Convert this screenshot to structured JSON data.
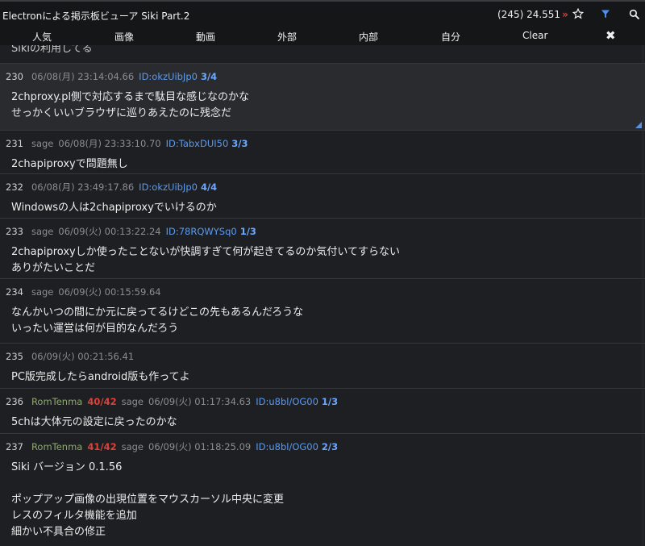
{
  "app": {
    "title": "Electronによる掲示板ビューア Siki Part.2",
    "count": "(245) 24.551",
    "up_glyph": "»"
  },
  "tabs": [
    "人気",
    "画像",
    "動画",
    "外部",
    "内部",
    "自分",
    "Clear"
  ],
  "close_glyph": "✖",
  "cut_text": "Sikiの利用してる",
  "posts": [
    {
      "num": "230",
      "name": "",
      "res_count": "",
      "mail": "",
      "date": "06/08(月) 23:14:04.66",
      "id": "ID:okzUibJp0",
      "id_count": "3/4",
      "lines": [
        "2chproxy.pl側で対応するまで駄目な感じなのかな",
        "せっかくいいブラウザに巡りあえたのに残念だ"
      ],
      "highlight": true
    },
    {
      "num": "231",
      "name": "",
      "res_count": "",
      "mail": "sage",
      "date": "06/08(月) 23:33:10.70",
      "id": "ID:TabxDUI50",
      "id_count": "3/3",
      "lines": [
        "2chapiproxyで問題無し"
      ]
    },
    {
      "num": "232",
      "name": "",
      "res_count": "",
      "mail": "",
      "date": "06/08(月) 23:49:17.86",
      "id": "ID:okzUibJp0",
      "id_count": "4/4",
      "lines": [
        "Windowsの人は2chapiproxyでいけるのか"
      ]
    },
    {
      "num": "233",
      "name": "",
      "res_count": "",
      "mail": "sage",
      "date": "06/09(火) 00:13:22.24",
      "id": "ID:78RQWYSq0",
      "id_count": "1/3",
      "lines": [
        "2chapiproxyしか使ったことないが快調すぎて何が起きてるのか気付いてすらない",
        "ありがたいことだ"
      ]
    },
    {
      "num": "234",
      "name": "",
      "res_count": "",
      "mail": "sage",
      "date": "06/09(火) 00:15:59.64",
      "id": "",
      "id_count": "",
      "lines": [
        "なんかいつの間にか元に戻ってるけどこの先もあるんだろうな",
        "いったい運営は何が目的なんだろう"
      ]
    },
    {
      "num": "235",
      "name": "",
      "res_count": "",
      "mail": "",
      "date": "06/09(火) 00:21:56.41",
      "id": "",
      "id_count": "",
      "lines": [
        "PC版完成したらandroid版も作ってよ"
      ]
    },
    {
      "num": "236",
      "name": "RomTenma",
      "res_count": "40/42",
      "mail": "sage",
      "date": "06/09(火) 01:17:34.63",
      "id": "ID:u8bl/OG00",
      "id_count": "1/3",
      "lines": [
        "5chは大体元の設定に戻ったのかな"
      ]
    },
    {
      "num": "237",
      "name": "RomTenma",
      "res_count": "41/42",
      "mail": "sage",
      "date": "06/09(火) 01:18:25.09",
      "id": "ID:u8bl/OG00",
      "id_count": "2/3",
      "lines": [
        "Siki バージョン 0.1.56",
        "",
        "ポップアップ画像の出現位置をマウスカーソル中央に変更",
        "レスのフィルタ機能を追加",
        "細かい不具合の修正"
      ]
    }
  ]
}
